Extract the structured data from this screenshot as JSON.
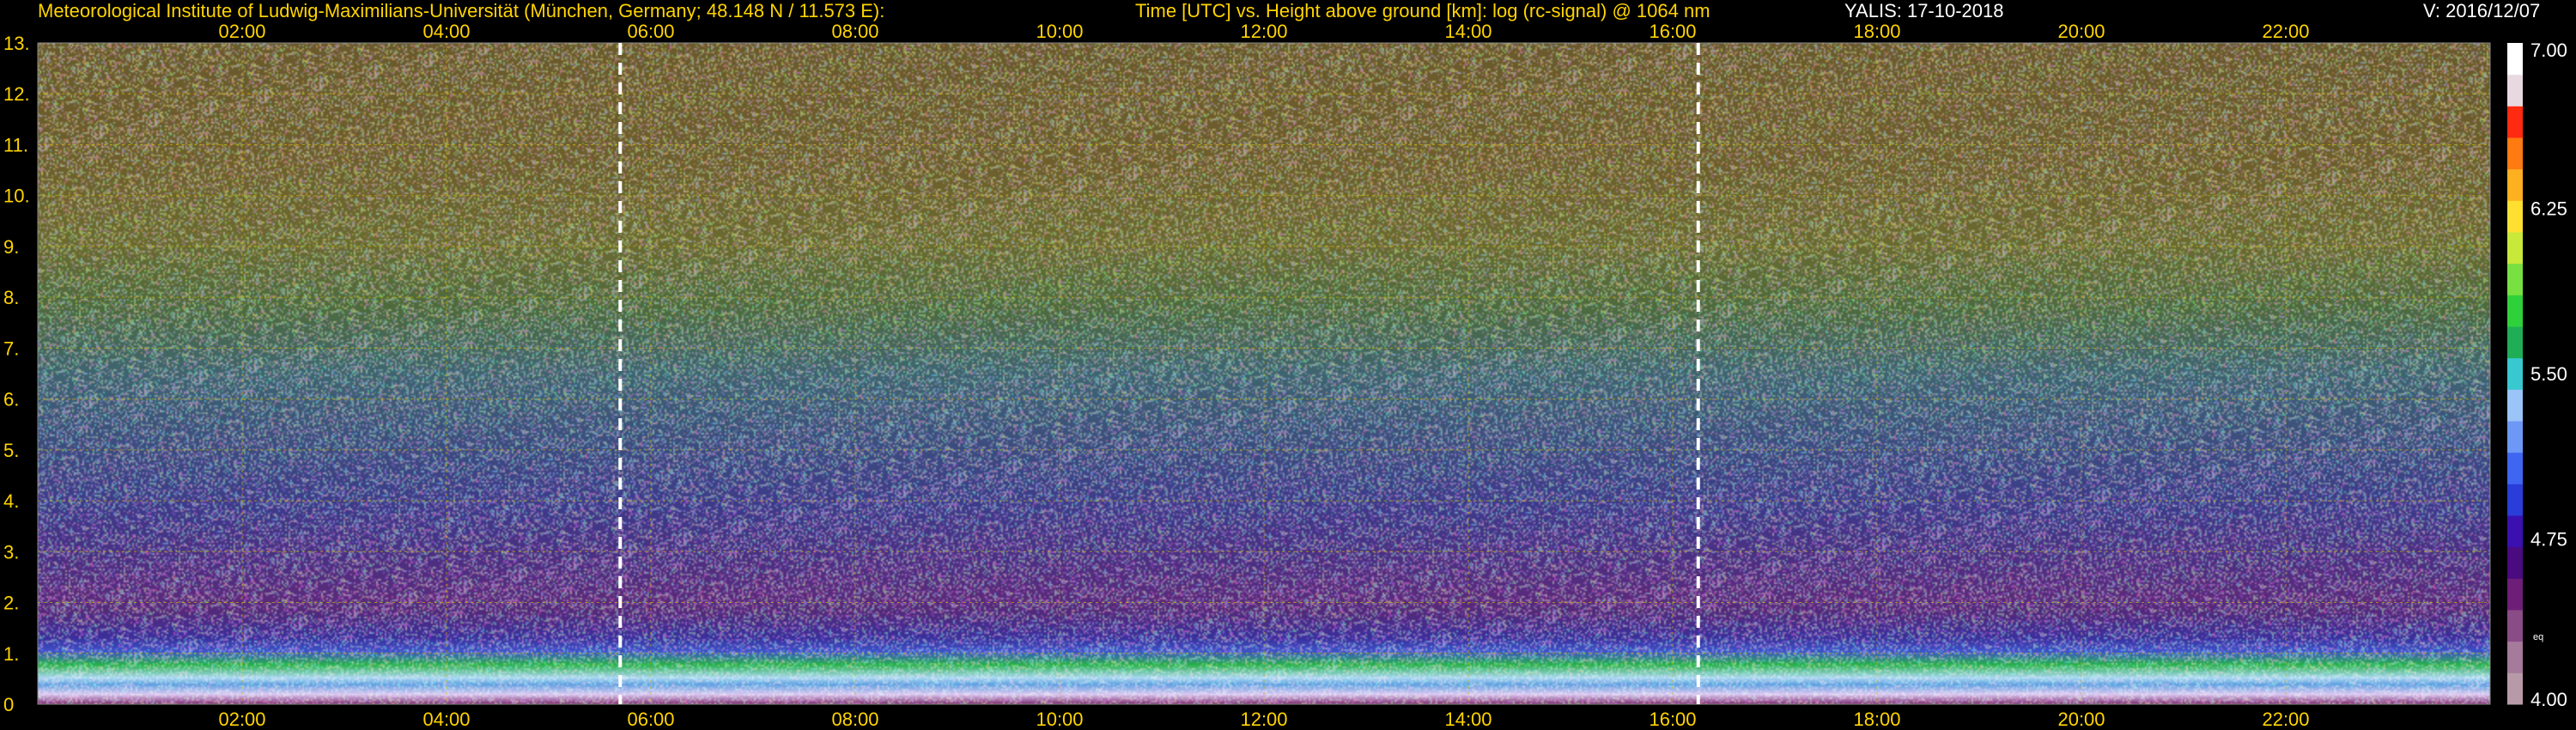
{
  "header": {
    "left": "Meteorological Institute of Ludwig-Maximilians-Universität (München, Germany; 48.148 N / 11.573 E):",
    "center": "Time [UTC] vs. Height above ground [km]: log (rc-signal) @ 1064 nm",
    "instrument": "YALIS: 17-10-2018",
    "version": "V: 2016/12/07"
  },
  "colors": {
    "text": "#ffd400",
    "grid": "#c8b400",
    "markers": "#ffffff"
  },
  "chart_data": {
    "type": "heatmap",
    "title": "Time [UTC] vs. Height above ground [km]: log (rc-signal) @ 1064 nm",
    "x": {
      "unit": "hours UTC",
      "range": [
        0,
        24
      ],
      "ticks": [
        2,
        4,
        6,
        8,
        10,
        12,
        14,
        16,
        18,
        20,
        22
      ],
      "tick_labels": [
        "02:00",
        "04:00",
        "06:00",
        "08:00",
        "10:00",
        "12:00",
        "14:00",
        "16:00",
        "18:00",
        "20:00",
        "22:00"
      ]
    },
    "y": {
      "unit": "km",
      "range": [
        0,
        13
      ],
      "ticks": [
        0,
        1,
        2,
        3,
        4,
        5,
        6,
        7,
        8,
        9,
        10,
        11,
        12,
        13
      ],
      "tick_labels": [
        "0",
        "1.",
        "2.",
        "3.",
        "4.",
        "5.",
        "6.",
        "7.",
        "8.",
        "9.",
        "10.",
        "11.",
        "12.",
        "13."
      ]
    },
    "grid": true,
    "dashed_markers_hours": [
      5.7,
      16.25
    ],
    "colorbar": {
      "range": [
        4.0,
        7.0
      ],
      "tick_values": [
        7.0,
        6.25,
        5.5,
        4.75,
        4.0
      ],
      "tick_labels": [
        "7.00",
        "6.25",
        "5.50",
        "4.75",
        "4.00"
      ],
      "extra_label": "eq",
      "colors": [
        "#b79aa8",
        "#a57a9b",
        "#8a4c86",
        "#6d1f78",
        "#4a0a80",
        "#3a10b0",
        "#2a3dd8",
        "#3f66f0",
        "#6e98f5",
        "#9bc4f8",
        "#38c8d0",
        "#1fae55",
        "#2fd13a",
        "#78e040",
        "#c8e83a",
        "#ffe030",
        "#ffb020",
        "#ff7a10",
        "#ff2a10",
        "#e8d8e0",
        "#ffffff"
      ]
    }
  }
}
